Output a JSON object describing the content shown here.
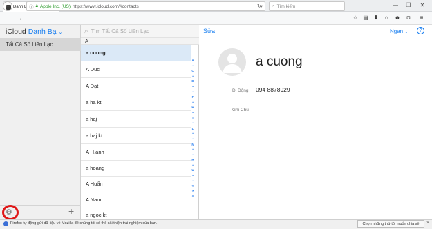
{
  "browser": {
    "tab_title": "Danh Bạ iCloud",
    "tab_close": "×",
    "new_tab": "+",
    "window_buttons": [
      "—",
      "❐",
      "✕"
    ],
    "url_secure_label": "Apple Inc. (US)",
    "url": "https://www.icloud.com/#contacts",
    "search_placeholder": "Tìm kiếm"
  },
  "app": {
    "brand": "iCloud",
    "section": "Danh Bạ",
    "group_selected": "Tất Cả Số Liên Lạc",
    "search_placeholder": "Tìm Tất Cả Số Liên Lạc",
    "section_letter": "A",
    "edit_label": "Sửa",
    "sort_label": "Ngan",
    "help_label": "?"
  },
  "contacts": [
    {
      "label": "a cuong"
    },
    {
      "label": "A Duc"
    },
    {
      "label": "A Đạt"
    },
    {
      "label": "a ha kt"
    },
    {
      "label": "a haj"
    },
    {
      "label": "a haj kt"
    },
    {
      "label": "A H.anh"
    },
    {
      "label": "a hoang"
    },
    {
      "label": "A Huấn"
    },
    {
      "label": "A Nam"
    },
    {
      "label": "a ngoc kt"
    }
  ],
  "index_letters": [
    "A",
    "•",
    "C",
    "•",
    "D",
    "•",
    "•",
    "F",
    "•",
    "H",
    "•",
    "I",
    "•",
    "L",
    "•",
    "•",
    "N",
    "•",
    "•",
    "R",
    "•",
    "U",
    "•",
    "•",
    "Y",
    "Z",
    "#"
  ],
  "detail": {
    "name": "a cuong",
    "phone_label": "Di Động",
    "phone_value": "094 8878929",
    "note_label": "Ghi Chú"
  },
  "notification": {
    "text": "Firefox tự động gửi dữ liệu về Mozilla để chúng tôi có thể cải thiện trải nghiệm của bạn.",
    "button": "Chọn những thứ tôi muốn chia sẻ",
    "close": "×"
  }
}
